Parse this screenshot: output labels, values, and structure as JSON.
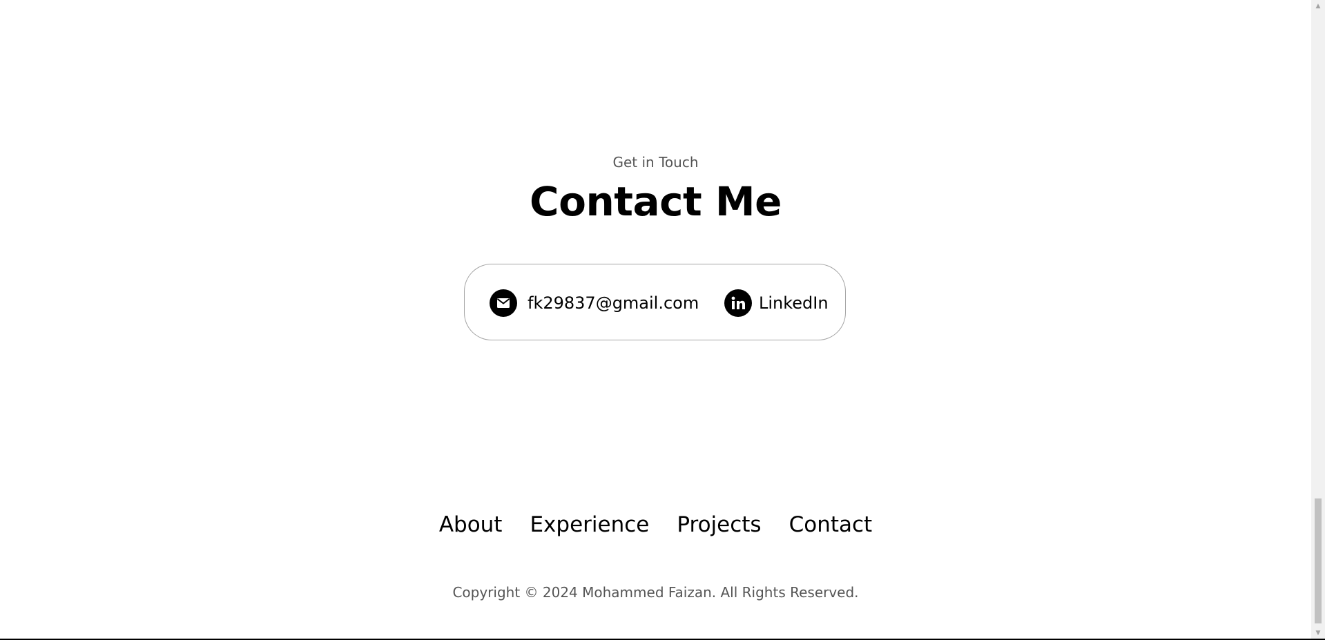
{
  "contact": {
    "subtitle": "Get in Touch",
    "title": "Contact Me",
    "email": {
      "icon": "mail-icon",
      "text": "fk29837@gmail.com"
    },
    "linkedin": {
      "icon": "linkedin-icon",
      "text": "LinkedIn"
    }
  },
  "footer": {
    "nav": [
      {
        "label": "About"
      },
      {
        "label": "Experience"
      },
      {
        "label": "Projects"
      },
      {
        "label": "Contact"
      }
    ],
    "copyright": "Copyright © 2024 Mohammed Faizan. All Rights Reserved."
  },
  "colors": {
    "background": "#ffffff",
    "text": "#000000",
    "muted_text": "#555555",
    "border": "#a3a3a3"
  }
}
